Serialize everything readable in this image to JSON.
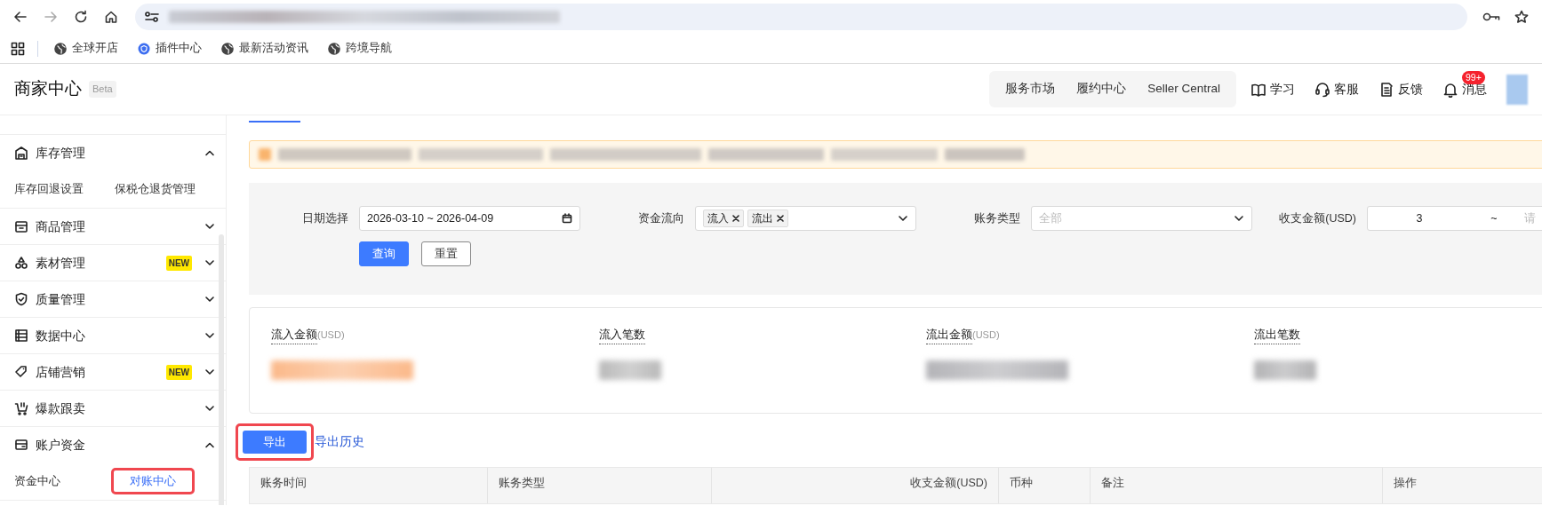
{
  "browser": {
    "forward_disabled": true,
    "bookmarks": [
      {
        "kind": "globe",
        "label": "全球开店"
      },
      {
        "kind": "plugin",
        "label": "插件中心"
      },
      {
        "kind": "globe",
        "label": "最新活动资讯"
      },
      {
        "kind": "globe",
        "label": "跨境导航"
      }
    ]
  },
  "header": {
    "title": "商家中心",
    "badge": "Beta",
    "nav": [
      "服务市场",
      "履约中心",
      "Seller Central"
    ],
    "actions": [
      {
        "kind": "book",
        "label": "学习"
      },
      {
        "kind": "headset",
        "label": "客服"
      },
      {
        "kind": "feedback",
        "label": "反馈"
      },
      {
        "kind": "bell",
        "label": "消息",
        "count": "99+"
      }
    ]
  },
  "sidebar": {
    "groups": [
      {
        "kind": "warehouse",
        "label": "库存管理",
        "expanded": true,
        "children": [
          {
            "label": "库存回退设置",
            "selected": false,
            "outlined": false
          },
          {
            "label": "保税仓退货管理",
            "selected": false,
            "outlined": false
          }
        ]
      },
      {
        "kind": "box",
        "label": "商品管理",
        "expanded": false
      },
      {
        "kind": "shapes",
        "label": "素材管理",
        "tag": "NEW",
        "expanded": false
      },
      {
        "kind": "shield",
        "label": "质量管理",
        "expanded": false
      },
      {
        "kind": "data",
        "label": "数据中心",
        "expanded": false
      },
      {
        "kind": "tag",
        "label": "店铺营销",
        "tag": "NEW",
        "expanded": false
      },
      {
        "kind": "cart",
        "label": "爆款跟卖",
        "expanded": false
      },
      {
        "kind": "wallet",
        "label": "账户资金",
        "expanded": true,
        "children": [
          {
            "label": "资金中心",
            "selected": false,
            "outlined": false
          },
          {
            "label": "对账中心",
            "selected": true,
            "outlined": true
          }
        ]
      }
    ]
  },
  "filters": [
    {
      "kind": "date",
      "label": "日期选择",
      "value": "2026-03-10 ~ 2026-04-09"
    },
    {
      "kind": "tags",
      "label": "资金流向",
      "tags": [
        "流入",
        "流出"
      ]
    },
    {
      "kind": "select",
      "label": "账务类型",
      "placeholder": "全部"
    },
    {
      "kind": "range",
      "label": "收支金额(USD)",
      "value": "3",
      "separator": "~",
      "placeholder": "请"
    }
  ],
  "filter_buttons": [
    {
      "kind": "primary",
      "label": "查询"
    },
    {
      "kind": "default",
      "label": "重置"
    }
  ],
  "stats": [
    {
      "label": "流入金额",
      "unit": "(USD)",
      "color": "#fbb98a"
    },
    {
      "label": "流入笔数",
      "color": "#b9b9b9"
    },
    {
      "label": "流出金额",
      "unit": "(USD)",
      "color": "#b4b4b8"
    },
    {
      "label": "流出笔数",
      "color": "#b2b2b4"
    }
  ],
  "export": {
    "label": "导出",
    "outlined": true
  },
  "history_link": "导出历史",
  "table": {
    "columns": [
      {
        "label": "账务时间",
        "kind": "text"
      },
      {
        "label": "账务类型",
        "kind": "text"
      },
      {
        "label": "收支金额(USD)",
        "kind": "amount"
      },
      {
        "label": "币种",
        "kind": "text"
      },
      {
        "label": "备注",
        "kind": "text"
      },
      {
        "label": "操作",
        "kind": "text"
      }
    ]
  }
}
